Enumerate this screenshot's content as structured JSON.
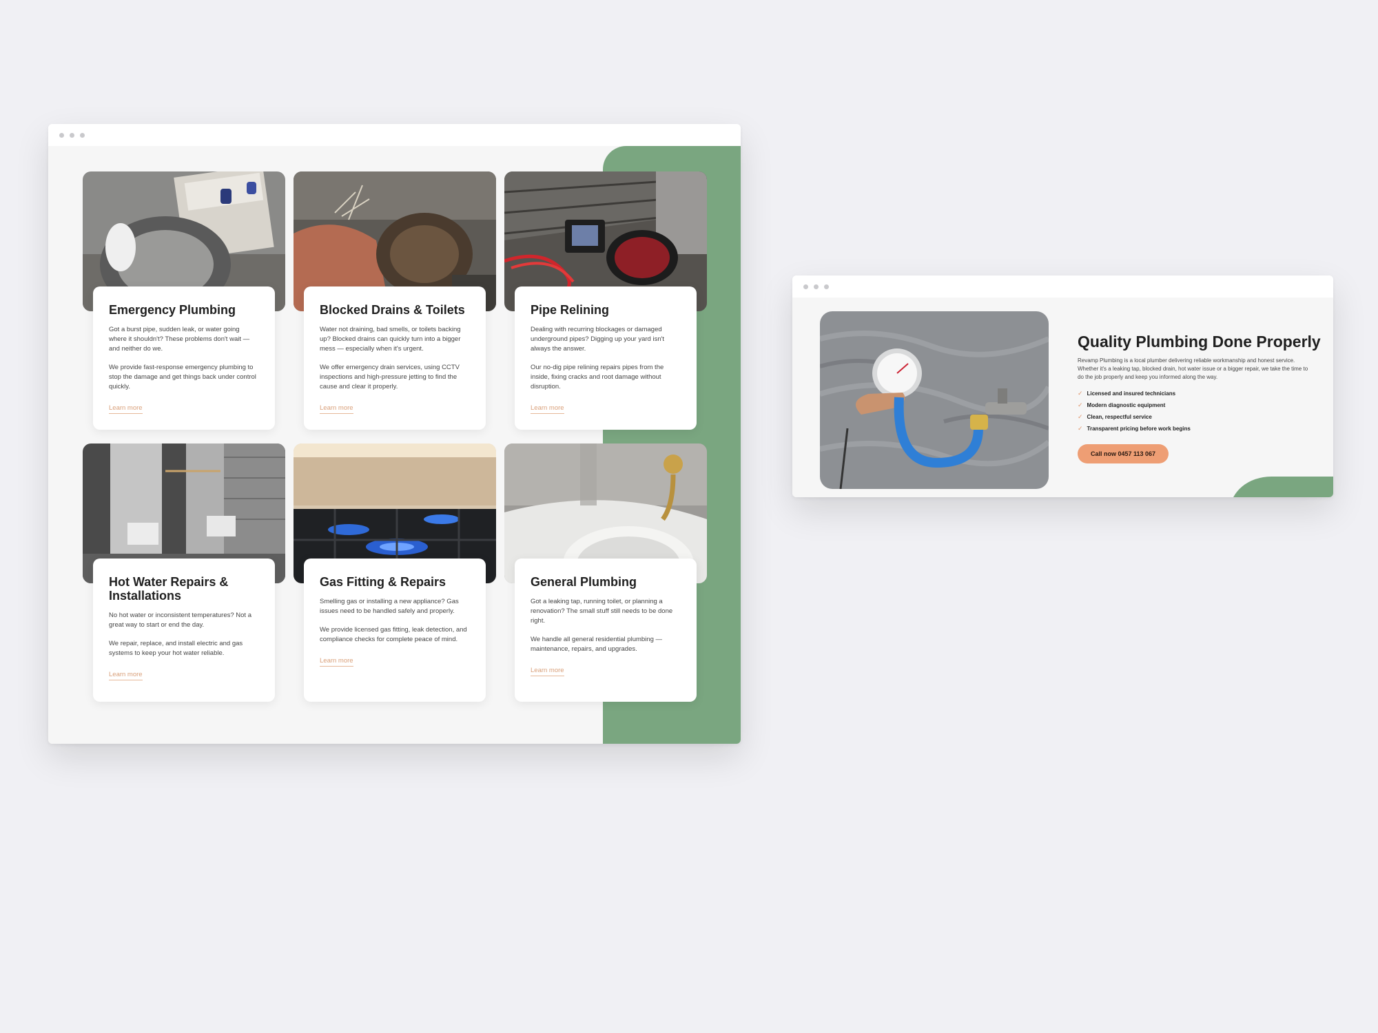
{
  "services_window": {
    "cards": [
      {
        "title": "Emergency Plumbing",
        "p1": "Got a burst pipe, sudden leak, or water going where it shouldn't? These problems don't wait — and neither do we.",
        "p2": "We provide fast-response emergency plumbing to stop the damage and get things back under control quickly.",
        "link": "Learn more"
      },
      {
        "title": "Blocked Drains & Toilets",
        "p1": "Water not draining, bad smells, or toilets backing up? Blocked drains can quickly turn into a bigger mess — especially when it's urgent.",
        "p2": "We offer emergency drain services, using CCTV inspections and high-pressure jetting to find the cause and clear it properly.",
        "link": "Learn more"
      },
      {
        "title": "Pipe Relining",
        "p1": "Dealing with recurring blockages or damaged underground pipes? Digging up your yard isn't always the answer.",
        "p2": "Our no-dig pipe relining repairs pipes from the inside, fixing cracks and root damage without disruption.",
        "link": "Learn more"
      },
      {
        "title": "Hot Water Repairs & Installations",
        "p1": "No hot water or inconsistent temperatures? Not a great way to start or end the day.",
        "p2": "We repair, replace, and install electric and gas systems to keep your hot water reliable.",
        "link": "Learn more"
      },
      {
        "title": "Gas Fitting & Repairs",
        "p1": "Smelling gas or installing a new appliance? Gas issues need to be handled safely and properly.",
        "p2": "We provide licensed gas fitting, leak detection, and compliance checks for complete peace of mind.",
        "link": "Learn more"
      },
      {
        "title": "General Plumbing",
        "p1": "Got a leaking tap, running toilet, or planning a renovation? The small stuff still needs to be done right.",
        "p2": "We handle all general residential plumbing — maintenance, repairs, and upgrades.",
        "link": "Learn more"
      }
    ]
  },
  "quality_window": {
    "title": "Quality Plumbing Done Properly",
    "description": "Revamp Plumbing is a local plumber delivering reliable workmanship and honest service. Whether it's a leaking tap, blocked drain, hot water issue or a bigger repair, we take the time to do the job properly and keep you informed along the way.",
    "features": [
      "Licensed and insured technicians",
      "Modern diagnostic equipment",
      "Clean, respectful service",
      "Transparent pricing before work begins"
    ],
    "cta": "Call now 0457 113 067"
  },
  "colors": {
    "accent_green": "#7aa680",
    "accent_orange": "#ee9e74",
    "link_color": "#d9a07a"
  }
}
